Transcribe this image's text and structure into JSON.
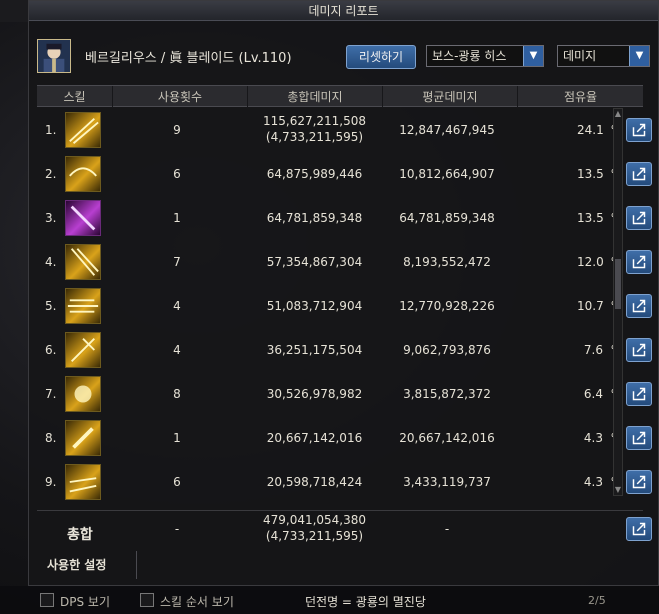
{
  "window": {
    "title": "데미지 리포트"
  },
  "character": {
    "name": "베르길리우스 / 眞 블레이드 (Lv.110)"
  },
  "controls": {
    "reset_label": "리셋하기",
    "target_select": "보스-광룡 히스",
    "metric_select": "데미지"
  },
  "columns": {
    "skill": "스킬",
    "uses": "사용횟수",
    "total": "총합데미지",
    "avg": "평균데미지",
    "share": "점유율"
  },
  "rows": [
    {
      "rank": "1.",
      "uses": "9",
      "total": "115,627,211,508",
      "sub": "(4,733,211,595)",
      "avg": "12,847,467,945",
      "share": "24.1",
      "pct": "%"
    },
    {
      "rank": "2.",
      "uses": "6",
      "total": "64,875,989,446",
      "sub": "",
      "avg": "10,812,664,907",
      "share": "13.5",
      "pct": "%"
    },
    {
      "rank": "3.",
      "uses": "1",
      "total": "64,781,859,348",
      "sub": "",
      "avg": "64,781,859,348",
      "share": "13.5",
      "pct": "%"
    },
    {
      "rank": "4.",
      "uses": "7",
      "total": "57,354,867,304",
      "sub": "",
      "avg": "8,193,552,472",
      "share": "12.0",
      "pct": "%"
    },
    {
      "rank": "5.",
      "uses": "4",
      "total": "51,083,712,904",
      "sub": "",
      "avg": "12,770,928,226",
      "share": "10.7",
      "pct": "%"
    },
    {
      "rank": "6.",
      "uses": "4",
      "total": "36,251,175,504",
      "sub": "",
      "avg": "9,062,793,876",
      "share": "7.6",
      "pct": "%"
    },
    {
      "rank": "7.",
      "uses": "8",
      "total": "30,526,978,982",
      "sub": "",
      "avg": "3,815,872,372",
      "share": "6.4",
      "pct": "%"
    },
    {
      "rank": "8.",
      "uses": "1",
      "total": "20,667,142,016",
      "sub": "",
      "avg": "20,667,142,016",
      "share": "4.3",
      "pct": "%"
    },
    {
      "rank": "9.",
      "uses": "6",
      "total": "20,598,718,424",
      "sub": "",
      "avg": "3,433,119,737",
      "share": "4.3",
      "pct": "%"
    }
  ],
  "total": {
    "label": "총합",
    "uses": "-",
    "total": "479,041,054,380",
    "sub": "(4,733,211,595)",
    "avg": "-"
  },
  "settings": {
    "label": "사용한 설정"
  },
  "bottom": {
    "dps_label": "DPS 보기",
    "skill_order_label": "스킬 순서 보기",
    "dungeon_text": "던전명 = 광룡의 멸진당",
    "page": "2/5"
  },
  "colors": {
    "accent": "#2f5fa0",
    "gold": "#d9a21a",
    "purple": "#b83fd0"
  }
}
